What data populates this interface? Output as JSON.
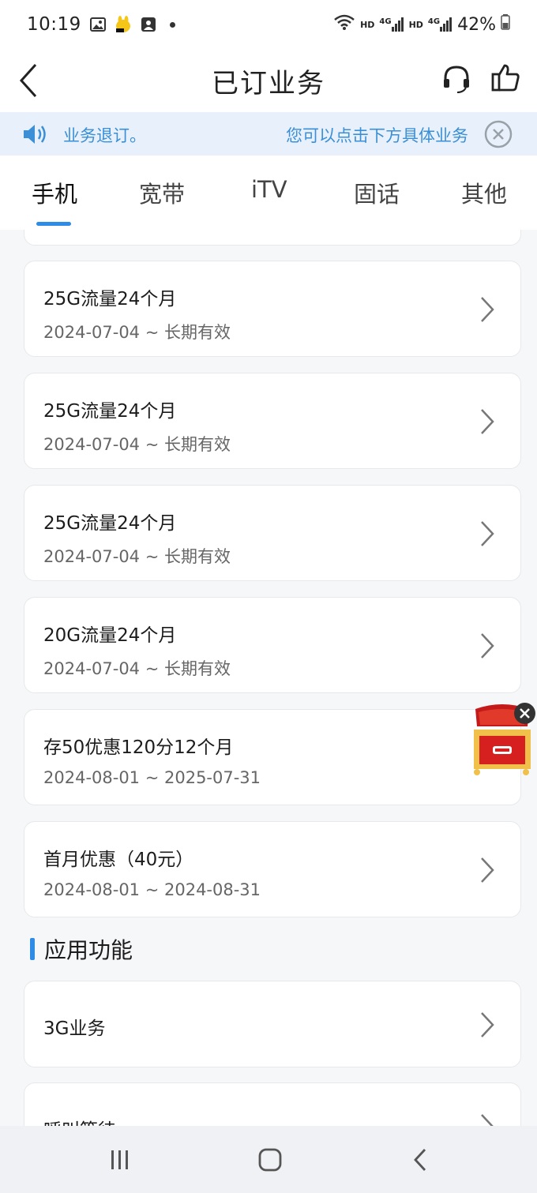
{
  "status_bar": {
    "time": "10:19",
    "battery": "42%",
    "net1": "4G",
    "net2": "4G",
    "hd1": "HD",
    "hd2": "HD",
    "icons": [
      "image-icon",
      "app-notification-icon",
      "contact-icon",
      "wifi-icon",
      "signal-icon",
      "battery-icon"
    ]
  },
  "header": {
    "title": "已订业务",
    "icons": [
      "back-icon",
      "headset-icon",
      "thumbs-up-icon"
    ]
  },
  "notice": {
    "text_left": "业务退订。",
    "text_right": "您可以点击下方具体业务",
    "icons": [
      "speaker-icon",
      "close-icon"
    ]
  },
  "tabs": [
    {
      "label": "手机",
      "active": true
    },
    {
      "label": "宽带",
      "active": false
    },
    {
      "label": "iTV",
      "active": false
    },
    {
      "label": "固话",
      "active": false
    },
    {
      "label": "其他",
      "active": false
    }
  ],
  "subscriptions": [
    {
      "title": "25G流量24个月",
      "date": "2024-07-04 ~ 长期有效"
    },
    {
      "title": "25G流量24个月",
      "date": "2024-07-04 ~ 长期有效"
    },
    {
      "title": "25G流量24个月",
      "date": "2024-07-04 ~ 长期有效"
    },
    {
      "title": "20G流量24个月",
      "date": "2024-07-04 ~ 长期有效"
    },
    {
      "title": "存50优惠120分12个月",
      "date": "2024-08-01 ~ 2025-07-31"
    },
    {
      "title": "首月优惠（40元）",
      "date": "2024-08-01 ~ 2024-08-31"
    }
  ],
  "section": {
    "title": "应用功能"
  },
  "app_features": [
    {
      "title": "3G业务"
    },
    {
      "title": "呼叫等待"
    }
  ],
  "colors": {
    "accent": "#2f8ce6",
    "notice_bg": "#e8f1fb",
    "notice_text": "#3b8fd6",
    "page_bg": "#f6f7f9"
  },
  "nav_bar": {
    "icons": [
      "recent-apps-icon",
      "home-icon",
      "back-nav-icon"
    ]
  }
}
